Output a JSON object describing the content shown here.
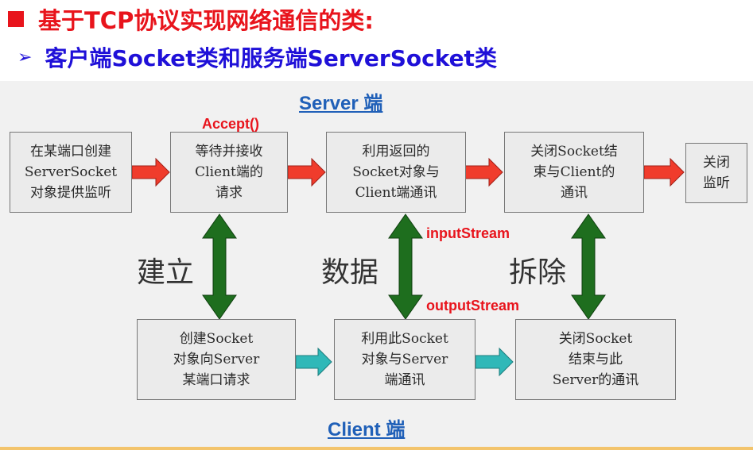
{
  "heading1": "基于TCP协议实现网络通信的类:",
  "heading2": "客户端Socket类和服务端ServerSocket类",
  "server_label": "Server 端",
  "client_label": "Client 端",
  "accept_label": "Accept()",
  "input_stream_label": "inputStream",
  "output_stream_label": "outputStream",
  "establish_label": "建立",
  "data_label": "数据",
  "teardown_label": "拆除",
  "server_boxes": [
    "在某端口创建\nServerSocket\n对象提供监听",
    "等待并接收\nClient端的\n请求",
    "利用返回的\nSocket对象与\nClient端通讯",
    "关闭Socket结\n束与Client的\n通讯",
    "关闭\n监听"
  ],
  "client_boxes": [
    "创建Socket\n对象向Server\n某端口请求",
    "利用此Socket\n对象与Server\n端通讯",
    "关闭Socket\n结束与此\nServer的通讯"
  ],
  "colors": {
    "heading_red": "#e8141c",
    "heading_blue": "#1f10d8",
    "server_arrow": "#f03c2c",
    "client_arrow": "#30b8b8",
    "vertical_arrow": "#1e6e1e"
  }
}
